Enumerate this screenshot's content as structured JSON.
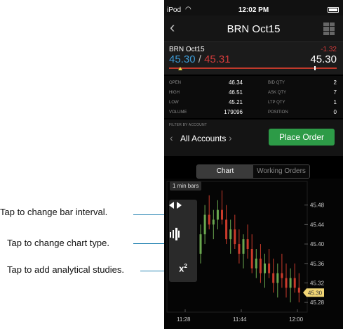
{
  "callouts": [
    "Tap to change bar interval.",
    "Tap to change chart type.",
    "Tap to add analytical studies."
  ],
  "status_bar": {
    "carrier": "iPod",
    "time": "12:02 PM"
  },
  "nav": {
    "title": "BRN Oct15"
  },
  "quote": {
    "symbol": "BRN Oct15",
    "bid": "45.30",
    "separator": "/",
    "ask": "45.31",
    "change": "-1.32",
    "last": "45.30"
  },
  "stats": {
    "left": [
      {
        "label": "OPEN",
        "value": "46.34"
      },
      {
        "label": "HIGH",
        "value": "46.51"
      },
      {
        "label": "LOW",
        "value": "45.21"
      },
      {
        "label": "VOLUME",
        "value": "179096"
      }
    ],
    "right": [
      {
        "label": "BID QTY",
        "value": "2"
      },
      {
        "label": "ASK QTY",
        "value": "7"
      },
      {
        "label": "LTP QTY",
        "value": "1"
      },
      {
        "label": "POSITION",
        "value": "0"
      }
    ]
  },
  "filter": {
    "label": "FILTER BY ACCOUNT",
    "account": "All Accounts",
    "place_order": "Place Order"
  },
  "tabs": [
    "Chart",
    "Working Orders"
  ],
  "chart": {
    "interval_label": "1 min bars",
    "current_price": "45.30",
    "colors": {
      "up": "#6aa84f",
      "down": "#cc3b2b",
      "price_tag": "#f2d675"
    }
  },
  "chart_data": {
    "type": "candlestick",
    "x_ticks": [
      "11:28",
      "11:44",
      "12:00"
    ],
    "y_ticks": [
      "45.48",
      "45.44",
      "45.40",
      "45.36",
      "45.32",
      "45.28"
    ],
    "ylim": [
      45.26,
      45.52
    ]
  }
}
